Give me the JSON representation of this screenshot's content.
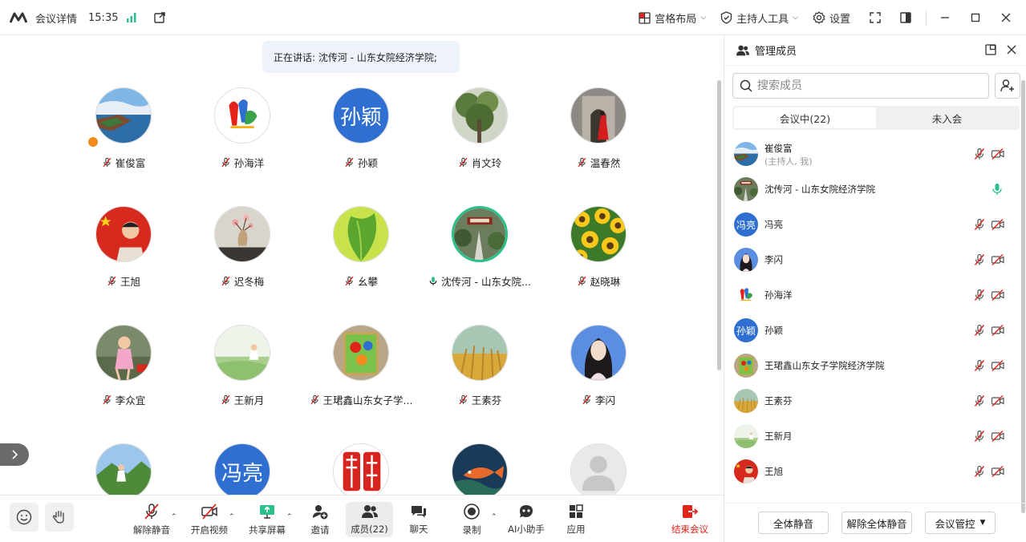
{
  "titlebar": {
    "meeting_info": "会议详情",
    "time": "15:35",
    "layout_label": "宫格布局",
    "host_tools_label": "主持人工具",
    "settings_label": "设置"
  },
  "speaker_banner": "正在讲话: 沈传河 - 山东女院经济学院;",
  "tiles": [
    {
      "name": "崔俊富",
      "avatar": "photo-lake"
    },
    {
      "name": "孙海洋",
      "avatar": "photo-logo"
    },
    {
      "name": "孙颖",
      "avatar_text": "孙颖"
    },
    {
      "name": "肖文玲",
      "avatar": "photo-tree"
    },
    {
      "name": "温春然",
      "avatar": "photo-church"
    },
    {
      "name": "王旭",
      "avatar": "photo-flag-kid"
    },
    {
      "name": "迟冬梅",
      "avatar": "photo-flower-vase"
    },
    {
      "name": "幺攀",
      "avatar": "photo-green-leaf"
    },
    {
      "name": "沈传河 - 山东女院...",
      "avatar": "photo-park"
    },
    {
      "name": "赵晓琳",
      "avatar": "photo-sunflowers"
    },
    {
      "name": "李众宜",
      "avatar": "photo-girl"
    },
    {
      "name": "王新月",
      "avatar": "photo-field"
    },
    {
      "name": "王珺鑫山东女子学...",
      "avatar": "photo-painting"
    },
    {
      "name": "王素芬",
      "avatar": "photo-wheat"
    },
    {
      "name": "李闪",
      "avatar": "photo-woman"
    },
    {
      "name": "",
      "avatar": "photo-mountain"
    },
    {
      "name": "",
      "avatar_text": "冯亮"
    },
    {
      "name": "",
      "avatar": "photo-seal"
    },
    {
      "name": "",
      "avatar": "photo-fish"
    },
    {
      "name": "",
      "avatar": "photo-default"
    }
  ],
  "toolbar": {
    "unmute": "解除静音",
    "start_video": "开启视频",
    "share_screen": "共享屏幕",
    "invite": "邀请",
    "members": "成员(22)",
    "chat": "聊天",
    "record": "录制",
    "ai_assistant": "AI小助手",
    "apps": "应用",
    "end_meeting": "结束会议"
  },
  "panel": {
    "title": "管理成员",
    "search_placeholder": "搜索成员",
    "tab_in_meeting": "会议中(22)",
    "tab_not_joined": "未入会",
    "members": [
      {
        "name": "崔俊富",
        "role": "(主持人, 我)",
        "avatar": "photo-lake"
      },
      {
        "name": "沈传河 - 山东女院经济学院",
        "avatar": "photo-park",
        "speaking": true
      },
      {
        "name": "冯亮",
        "avatar_text": "冯亮"
      },
      {
        "name": "李闪",
        "avatar": "photo-woman"
      },
      {
        "name": "孙海洋",
        "avatar": "photo-logo"
      },
      {
        "name": "孙颖",
        "avatar_text": "孙颖"
      },
      {
        "name": "王珺鑫山东女子学院经济学院",
        "avatar": "photo-painting"
      },
      {
        "name": "王素芬",
        "avatar": "photo-wheat"
      },
      {
        "name": "王新月",
        "avatar": "photo-field"
      },
      {
        "name": "王旭",
        "avatar": "photo-flag-kid"
      }
    ],
    "mute_all": "全体静音",
    "unmute_all": "解除全体静音",
    "meeting_control": "会议管控"
  },
  "colors": {
    "accent": "#2f6fd1",
    "active_speaker": "#2bbf8a",
    "end_red": "#e2231a",
    "muted_red": "#e2231a"
  }
}
